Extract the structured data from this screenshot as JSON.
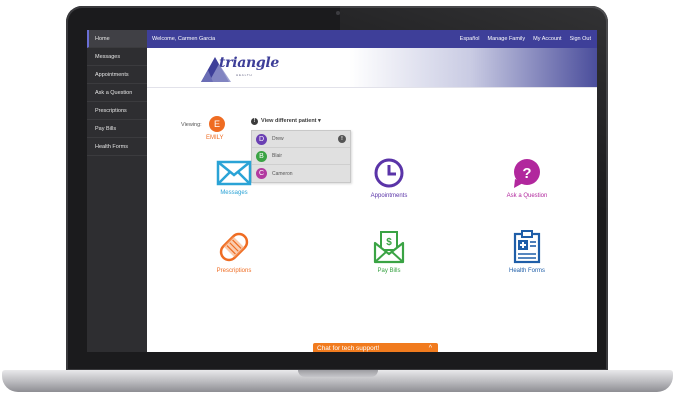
{
  "sidebar": {
    "items": [
      {
        "label": "Home"
      },
      {
        "label": "Messages"
      },
      {
        "label": "Appointments"
      },
      {
        "label": "Ask a Question"
      },
      {
        "label": "Prescriptions"
      },
      {
        "label": "Pay Bills"
      },
      {
        "label": "Health Forms"
      }
    ]
  },
  "header": {
    "welcome": "Welcome, Carmen Garcia",
    "links": [
      "Español",
      "Manage Family",
      "My Account",
      "Sign Out"
    ]
  },
  "logo": {
    "name": "triangle",
    "sub": "HEALTH"
  },
  "viewing": {
    "label": "Viewing:",
    "patient_initial": "E",
    "patient_name": "EMILY",
    "view_different": "View different patient ▾",
    "info_glyph": "!",
    "options": [
      {
        "initial": "D",
        "name": "Drew",
        "color": "#6a3fb3"
      },
      {
        "initial": "B",
        "name": "Blair",
        "color": "#3aa344"
      },
      {
        "initial": "C",
        "name": "Cameron",
        "color": "#b23aa0"
      }
    ]
  },
  "tiles": [
    {
      "label": "Messages",
      "icon": "envelope-icon",
      "color": "#2aa3d6"
    },
    {
      "label": "Appointments",
      "icon": "clock-icon",
      "color": "#5a34a8"
    },
    {
      "label": "Ask a Question",
      "icon": "question-bubble-icon",
      "color": "#b1279d"
    },
    {
      "label": "Prescriptions",
      "icon": "pill-icon",
      "color": "#ef6c22"
    },
    {
      "label": "Pay Bills",
      "icon": "bill-envelope-icon",
      "color": "#3aa344"
    },
    {
      "label": "Health Forms",
      "icon": "clipboard-icon",
      "color": "#1f5ea8"
    }
  ],
  "chat": {
    "label": "Chat for tech support!",
    "chevron": "^"
  },
  "colors": {
    "brand": "#3e3f99",
    "sidebar": "#2e2e31",
    "chat": "#f17b1e"
  }
}
